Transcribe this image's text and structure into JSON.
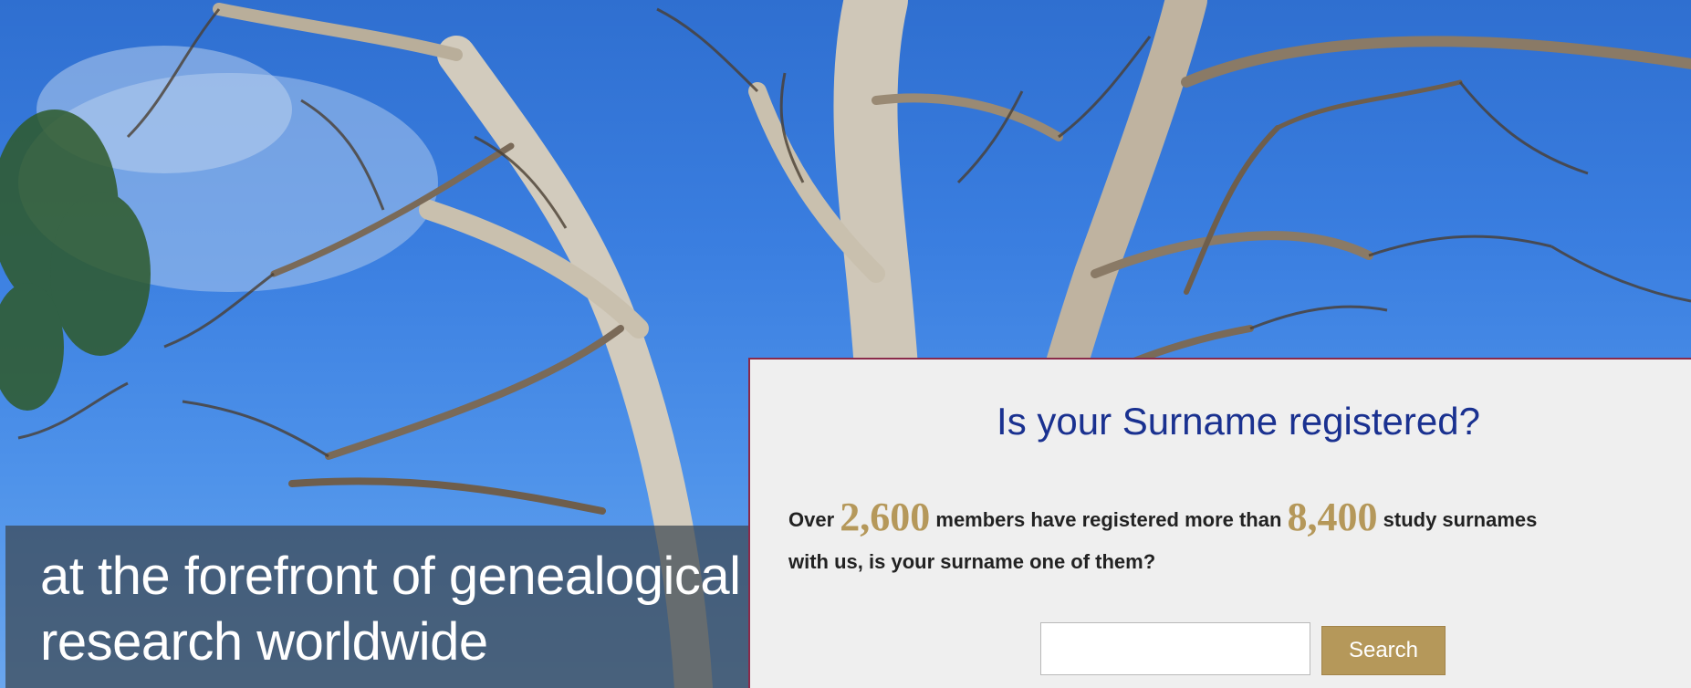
{
  "hero": {
    "tagline_line1": "at the forefront of genealogical",
    "tagline_line2": "research worldwide"
  },
  "surname_panel": {
    "title": "Is your Surname registered?",
    "text_prefix": "Over ",
    "members_count": "2,600",
    "text_middle": " members have registered more than ",
    "surnames_count": "8,400",
    "text_suffix": " study surnames",
    "text_line2": "with us, is your surname one of them?",
    "search_input_value": "",
    "search_button_label": "Search"
  },
  "colors": {
    "accent_gold": "#b5985a",
    "title_blue": "#1a3190",
    "panel_border": "#8a2a4a"
  }
}
